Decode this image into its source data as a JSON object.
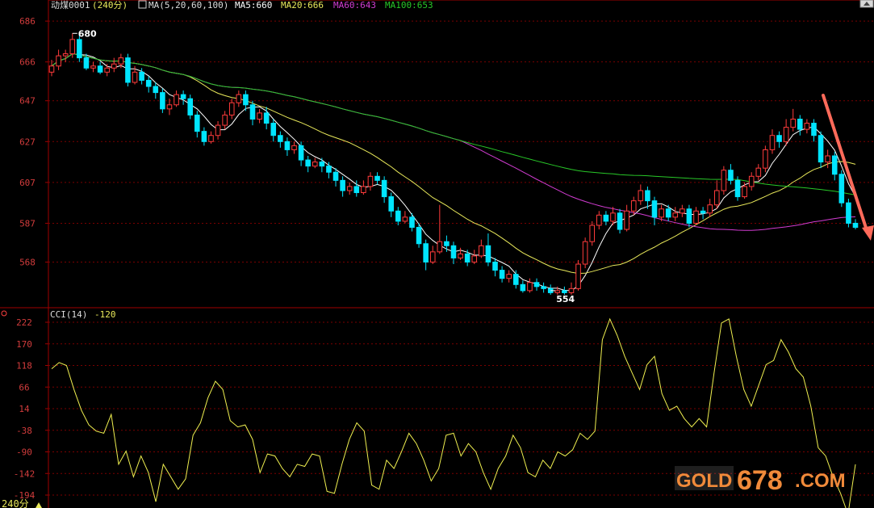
{
  "header": {
    "symbol": "动煤0001",
    "period": "(240分)",
    "ma_params": "MA(5,20,60,100)",
    "ma5": "MA5:660",
    "ma20": "MA20:666",
    "ma60": "MA60:643",
    "ma100": "MA100:653"
  },
  "cci_header": {
    "label": "CCI(14)",
    "value": "-120"
  },
  "footer": {
    "period_tab": "240分"
  },
  "watermark": {
    "text_gold": "GOLD",
    "text_num": "678",
    "text_com": ".COM"
  },
  "colors": {
    "bg": "#000000",
    "axis": "#a00000",
    "grid": "#7a0000",
    "tick": "#d23c3c",
    "up": "#ff3b3b",
    "down": "#00e5ff",
    "ma5": "#ffffff",
    "ma20": "#e8e85a",
    "ma60": "#d23cd2",
    "ma100": "#28c828",
    "cci": "#f0f050",
    "arrow": "#ff6a5a"
  },
  "chart_data": [
    {
      "type": "candlestick",
      "title": "动煤0001 (240分)",
      "yticks": [
        686,
        666,
        647,
        627,
        607,
        587,
        568
      ],
      "ylim": [
        550,
        690
      ],
      "annotations": [
        {
          "text": "680",
          "value": 680,
          "kind": "high"
        },
        {
          "text": "554",
          "value": 554,
          "kind": "low"
        }
      ],
      "candles": [
        [
          661,
          664,
          659,
          667
        ],
        [
          664,
          669,
          662,
          672
        ],
        [
          669,
          670,
          666,
          672
        ],
        [
          670,
          677,
          668,
          680
        ],
        [
          677,
          668,
          666,
          679
        ],
        [
          668,
          663,
          662,
          670
        ],
        [
          663,
          664,
          661,
          666
        ],
        [
          664,
          661,
          660,
          666
        ],
        [
          661,
          663,
          659,
          665
        ],
        [
          663,
          665,
          661,
          668
        ],
        [
          665,
          668,
          663,
          670
        ],
        [
          668,
          656,
          654,
          670
        ],
        [
          656,
          661,
          655,
          664
        ],
        [
          661,
          657,
          655,
          663
        ],
        [
          657,
          654,
          651,
          659
        ],
        [
          654,
          651,
          648,
          656
        ],
        [
          651,
          643,
          641,
          653
        ],
        [
          643,
          645,
          640,
          648
        ],
        [
          645,
          650,
          644,
          652
        ],
        [
          650,
          648,
          645,
          652
        ],
        [
          648,
          640,
          638,
          650
        ],
        [
          640,
          632,
          629,
          642
        ],
        [
          632,
          627,
          625,
          634
        ],
        [
          627,
          630,
          626,
          632
        ],
        [
          630,
          635,
          628,
          637
        ],
        [
          635,
          640,
          633,
          642
        ],
        [
          640,
          646,
          638,
          648
        ],
        [
          646,
          650,
          644,
          652
        ],
        [
          650,
          645,
          642,
          652
        ],
        [
          645,
          638,
          635,
          647
        ],
        [
          638,
          641,
          636,
          643
        ],
        [
          641,
          636,
          633,
          644
        ],
        [
          636,
          630,
          627,
          638
        ],
        [
          630,
          627,
          624,
          632
        ],
        [
          627,
          623,
          620,
          629
        ],
        [
          623,
          625,
          621,
          627
        ],
        [
          625,
          618,
          615,
          627
        ],
        [
          618,
          615,
          612,
          620
        ],
        [
          615,
          617,
          614,
          619
        ],
        [
          617,
          615,
          612,
          619
        ],
        [
          615,
          612,
          609,
          617
        ],
        [
          612,
          608,
          605,
          614
        ],
        [
          608,
          603,
          600,
          610
        ],
        [
          603,
          605,
          601,
          607
        ],
        [
          605,
          602,
          600,
          608
        ],
        [
          602,
          605,
          601,
          608
        ],
        [
          605,
          610,
          603,
          612
        ],
        [
          610,
          608,
          606,
          612
        ],
        [
          608,
          600,
          597,
          610
        ],
        [
          600,
          593,
          590,
          602
        ],
        [
          593,
          588,
          586,
          595
        ],
        [
          588,
          590,
          587,
          593
        ],
        [
          590,
          585,
          583,
          592
        ],
        [
          585,
          577,
          575,
          587
        ],
        [
          577,
          568,
          564,
          579
        ],
        [
          568,
          573,
          567,
          576
        ],
        [
          573,
          578,
          572,
          596
        ],
        [
          578,
          576,
          573,
          581
        ],
        [
          576,
          570,
          567,
          578
        ],
        [
          570,
          572,
          569,
          575
        ],
        [
          572,
          568,
          566,
          574
        ],
        [
          568,
          571,
          567,
          574
        ],
        [
          571,
          576,
          570,
          579
        ],
        [
          576,
          568,
          566,
          582
        ],
        [
          568,
          564,
          561,
          570
        ],
        [
          564,
          560,
          558,
          566
        ],
        [
          560,
          562,
          558,
          564
        ],
        [
          562,
          557,
          555,
          564
        ],
        [
          557,
          554,
          553,
          559
        ],
        [
          554,
          558,
          553,
          560
        ],
        [
          558,
          556,
          554,
          560
        ],
        [
          556,
          555,
          553,
          558
        ],
        [
          555,
          553,
          552,
          557
        ],
        [
          553,
          554,
          552,
          556
        ],
        [
          554,
          553,
          552,
          556
        ],
        [
          553,
          555,
          552,
          558
        ],
        [
          555,
          567,
          554,
          569
        ],
        [
          567,
          578,
          565,
          580
        ],
        [
          578,
          586,
          576,
          588
        ],
        [
          586,
          591,
          584,
          593
        ],
        [
          591,
          588,
          586,
          593
        ],
        [
          588,
          592,
          586,
          595
        ],
        [
          592,
          584,
          582,
          594
        ],
        [
          584,
          593,
          583,
          596
        ],
        [
          593,
          598,
          591,
          600
        ],
        [
          598,
          603,
          596,
          606
        ],
        [
          603,
          598,
          594,
          605
        ],
        [
          598,
          590,
          586,
          600
        ],
        [
          590,
          594,
          588,
          596
        ],
        [
          594,
          590,
          588,
          596
        ],
        [
          590,
          592,
          588,
          595
        ],
        [
          592,
          594,
          590,
          596
        ],
        [
          594,
          587,
          585,
          596
        ],
        [
          587,
          593,
          586,
          595
        ],
        [
          593,
          592,
          589,
          595
        ],
        [
          592,
          596,
          590,
          599
        ],
        [
          596,
          603,
          594,
          608
        ],
        [
          603,
          613,
          601,
          615
        ],
        [
          613,
          608,
          606,
          616
        ],
        [
          608,
          600,
          598,
          610
        ],
        [
          600,
          605,
          599,
          607
        ],
        [
          605,
          610,
          603,
          612
        ],
        [
          610,
          614,
          608,
          616
        ],
        [
          614,
          623,
          612,
          625
        ],
        [
          623,
          630,
          621,
          633
        ],
        [
          630,
          627,
          624,
          632
        ],
        [
          627,
          634,
          625,
          638
        ],
        [
          634,
          638,
          632,
          643
        ],
        [
          638,
          633,
          630,
          640
        ],
        [
          633,
          636,
          631,
          638
        ],
        [
          636,
          630,
          627,
          638
        ],
        [
          630,
          617,
          614,
          632
        ],
        [
          617,
          620,
          614,
          623
        ],
        [
          620,
          611,
          608,
          622
        ],
        [
          611,
          597,
          595,
          613
        ],
        [
          597,
          587,
          585,
          599
        ],
        [
          587,
          585,
          584,
          589
        ]
      ],
      "ma": [
        {
          "name": "MA5",
          "period": 5,
          "color_key": "ma5"
        },
        {
          "name": "MA20",
          "period": 20,
          "color_key": "ma20"
        },
        {
          "name": "MA60",
          "period": 60,
          "color_key": "ma60"
        },
        {
          "name": "MA100",
          "period": 100,
          "color_key": "ma100"
        }
      ]
    },
    {
      "type": "line",
      "title": "CCI(14)",
      "yticks": [
        222,
        170,
        118,
        66,
        14,
        -38,
        -90,
        -142,
        -194
      ],
      "ylim": [
        -240,
        240
      ],
      "series": [
        {
          "name": "CCI(14)",
          "values": [
            110,
            125,
            118,
            60,
            10,
            -25,
            -40,
            -45,
            0,
            -120,
            -88,
            -150,
            -100,
            -140,
            -210,
            -120,
            -150,
            -180,
            -155,
            -50,
            -20,
            40,
            80,
            60,
            -15,
            -30,
            -25,
            -60,
            -140,
            -95,
            -100,
            -130,
            -150,
            -120,
            -125,
            -95,
            -100,
            -185,
            -190,
            -120,
            -60,
            -20,
            -40,
            -170,
            -180,
            -110,
            -130,
            -90,
            -45,
            -70,
            -110,
            -160,
            -130,
            -50,
            -45,
            -100,
            -70,
            -90,
            -140,
            -180,
            -130,
            -100,
            -50,
            -80,
            -140,
            -150,
            -110,
            -130,
            -90,
            -100,
            -85,
            -45,
            -60,
            -40,
            180,
            230,
            190,
            140,
            100,
            60,
            120,
            140,
            50,
            10,
            20,
            -10,
            -30,
            -10,
            -30,
            100,
            220,
            230,
            140,
            60,
            20,
            70,
            120,
            130,
            180,
            150,
            110,
            90,
            20,
            -80,
            -100,
            -150,
            -190,
            -240,
            -120
          ],
          "color_key": "cci"
        }
      ]
    }
  ]
}
